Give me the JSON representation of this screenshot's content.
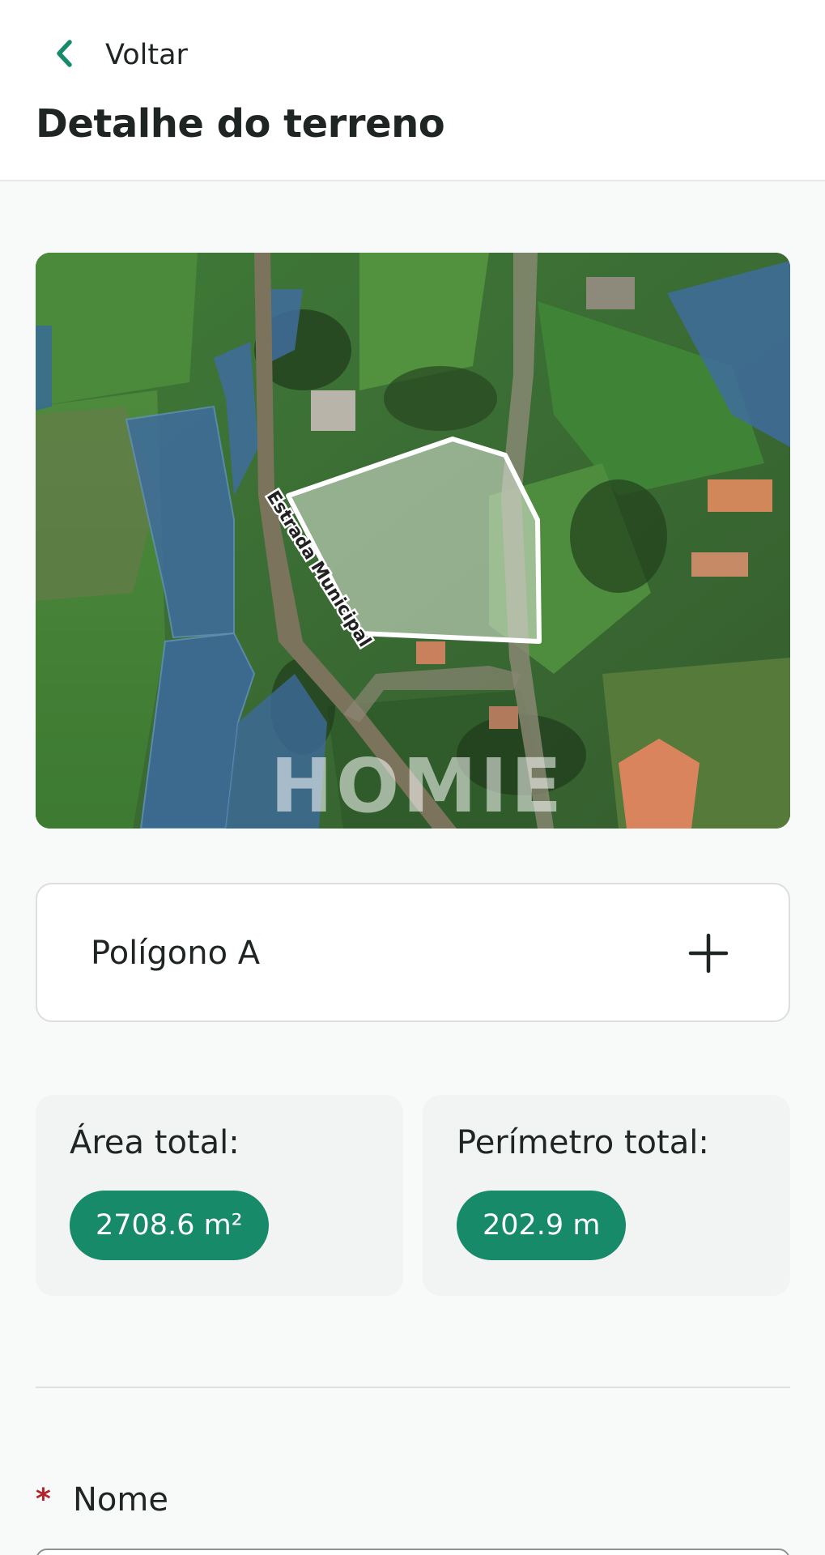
{
  "header": {
    "back_label": "Voltar",
    "title": "Detalhe do terreno"
  },
  "map": {
    "road_label": "Estrada Municipal",
    "watermark": "HOMIE"
  },
  "polygon_card": {
    "label": "Polígono A",
    "action_icon": "plus-icon"
  },
  "stats": {
    "area_label": "Área total:",
    "area_value": "2708.6 m²",
    "perimeter_label": "Perímetro total:",
    "perimeter_value": "202.9 m"
  },
  "form": {
    "required_marker": "*",
    "name_label": "Nome"
  },
  "colors": {
    "accent": "#178a69",
    "required": "#b4232a"
  }
}
